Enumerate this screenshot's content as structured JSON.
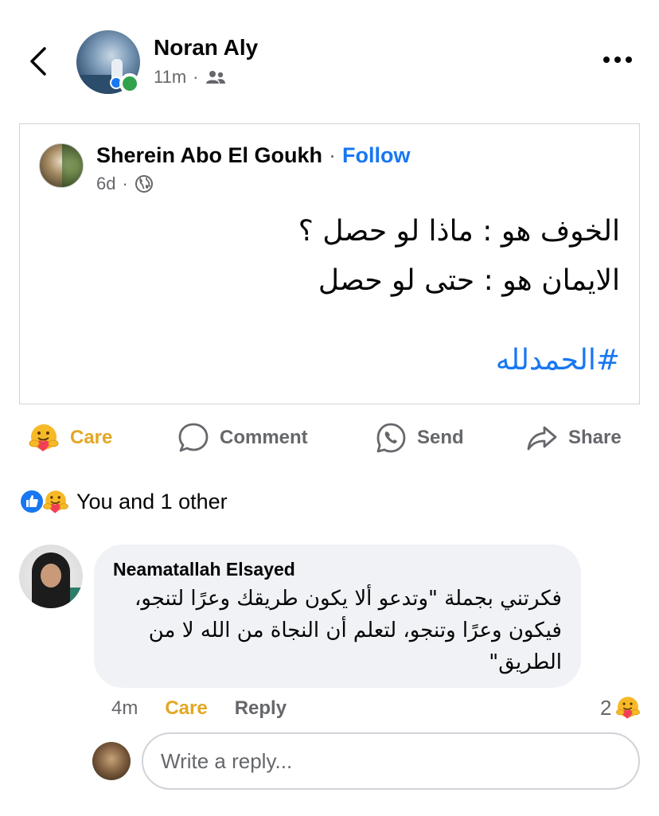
{
  "header": {
    "author_name": "Noran Aly",
    "time": "11m",
    "dot": "·",
    "audience_icon": "friends-icon",
    "back_icon": "chevron-left-icon",
    "more_icon": "more-dots-icon"
  },
  "shared_post": {
    "author_name": "Sherein Abo El Goukh",
    "separator": "·",
    "follow_label": "Follow",
    "time": "6d",
    "dot": "·",
    "audience_icon": "globe-icon",
    "lines": [
      "الخوف هو : ماذا لو حصل ؟",
      "الايمان هو : حتى لو حصل"
    ],
    "hashtag": "#الحمدلله"
  },
  "actions": {
    "care_label": "Care",
    "comment_label": "Comment",
    "send_label": "Send",
    "share_label": "Share"
  },
  "reactions": {
    "summary": "You and 1 other",
    "icons": [
      "like-icon",
      "care-icon"
    ]
  },
  "comment": {
    "author": "Neamatallah Elsayed",
    "text": "فكرتني بجملة \"وتدعو ألا يكون طريقك وعرًا لتنجو، فيكون وعرًا وتنجو، لتعلم أن النجاة من الله لا من الطريق\"",
    "time": "4m",
    "care_label": "Care",
    "reply_label": "Reply",
    "reaction_count": "2"
  },
  "reply_input": {
    "placeholder": "Write a reply..."
  },
  "colors": {
    "accent_blue": "#1877f2",
    "care_yellow": "#e3a723",
    "online_green": "#31a24c",
    "muted_gray": "#65676b",
    "bubble_bg": "#f0f2f5"
  }
}
